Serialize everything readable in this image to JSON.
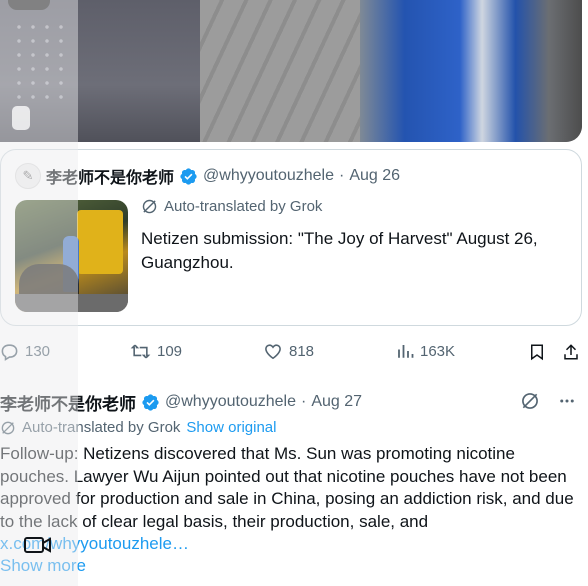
{
  "colors": {
    "accent": "#1d9bf0",
    "text": "#0f1419",
    "secondary": "#536471",
    "border": "#cfd9de"
  },
  "quoted_tweet": {
    "author_name": "李老师不是你老师",
    "handle": "@whyyoutouzhele",
    "separator": "·",
    "date": "Aug 26",
    "translate_note": "Auto-translated by Grok",
    "body": "Netizen submission: \"The Joy of Harvest\" August 26, Guangzhou."
  },
  "actions": {
    "reply_count": "130",
    "repost_count": "109",
    "like_count": "818",
    "view_count": "163K"
  },
  "tweet": {
    "author_name": "李老师不是你老师",
    "handle": "@whyyoutouzhele",
    "separator": "·",
    "date": "Aug 27",
    "translate_note": "Auto-translated by Grok",
    "show_original": "Show original",
    "body": "Follow-up: Netizens discovered that Ms. Sun was promoting nicotine pouches. Lawyer Wu Aijun pointed out that nicotine pouches have not been approved for production and sale in China, posing an addiction risk, and due to the lack of clear legal basis, their production, sale, and",
    "link": "x.com/whyyoutouzhele…",
    "show_more": "Show more"
  }
}
